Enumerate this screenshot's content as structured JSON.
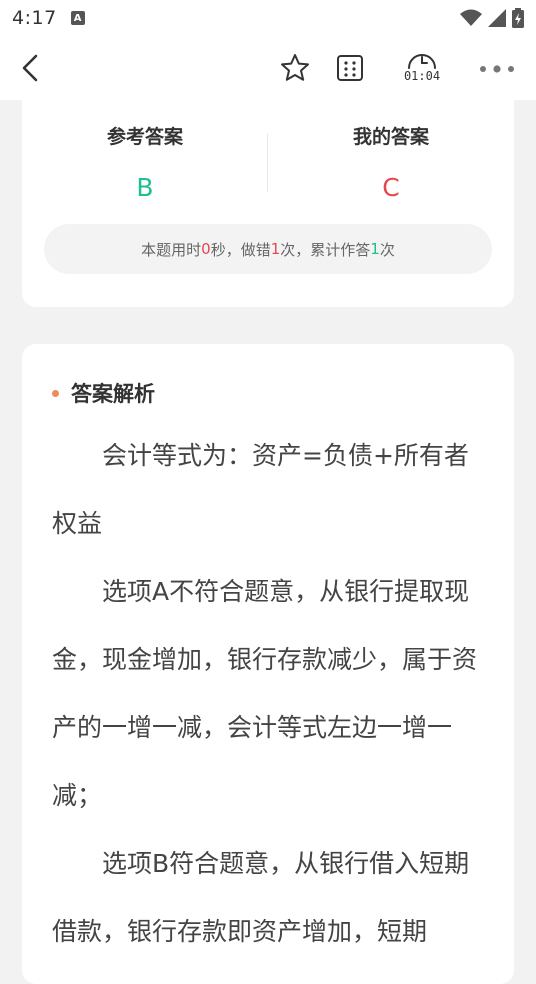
{
  "status_bar": {
    "time": "4:17",
    "notification_icon_letter": "A"
  },
  "nav": {
    "timer": "01:04"
  },
  "answer_card": {
    "reference_label": "参考答案",
    "reference_value": "B",
    "mine_label": "我的答案",
    "mine_value": "C",
    "stats": {
      "prefix": "本题用时 ",
      "seconds": "0",
      "mid1": "秒，做错",
      "wrong_count": "1",
      "mid2": "次，累计作答",
      "answer_count": "1",
      "suffix": "次"
    }
  },
  "analysis": {
    "title": "答案解析",
    "paragraphs": [
      "会计等式为：资产=负债+所有者权益",
      "选项A不符合题意，从银行提取现金，现金增加，银行存款减少，属于资产的一增一减，会计等式左边一增一减；",
      "选项B符合题意，从银行借入短期借款，银行存款即资产增加，短期"
    ]
  },
  "colors": {
    "correct": "#1fbf8f",
    "wrong": "#e5484d",
    "accent": "#f08a5d"
  }
}
